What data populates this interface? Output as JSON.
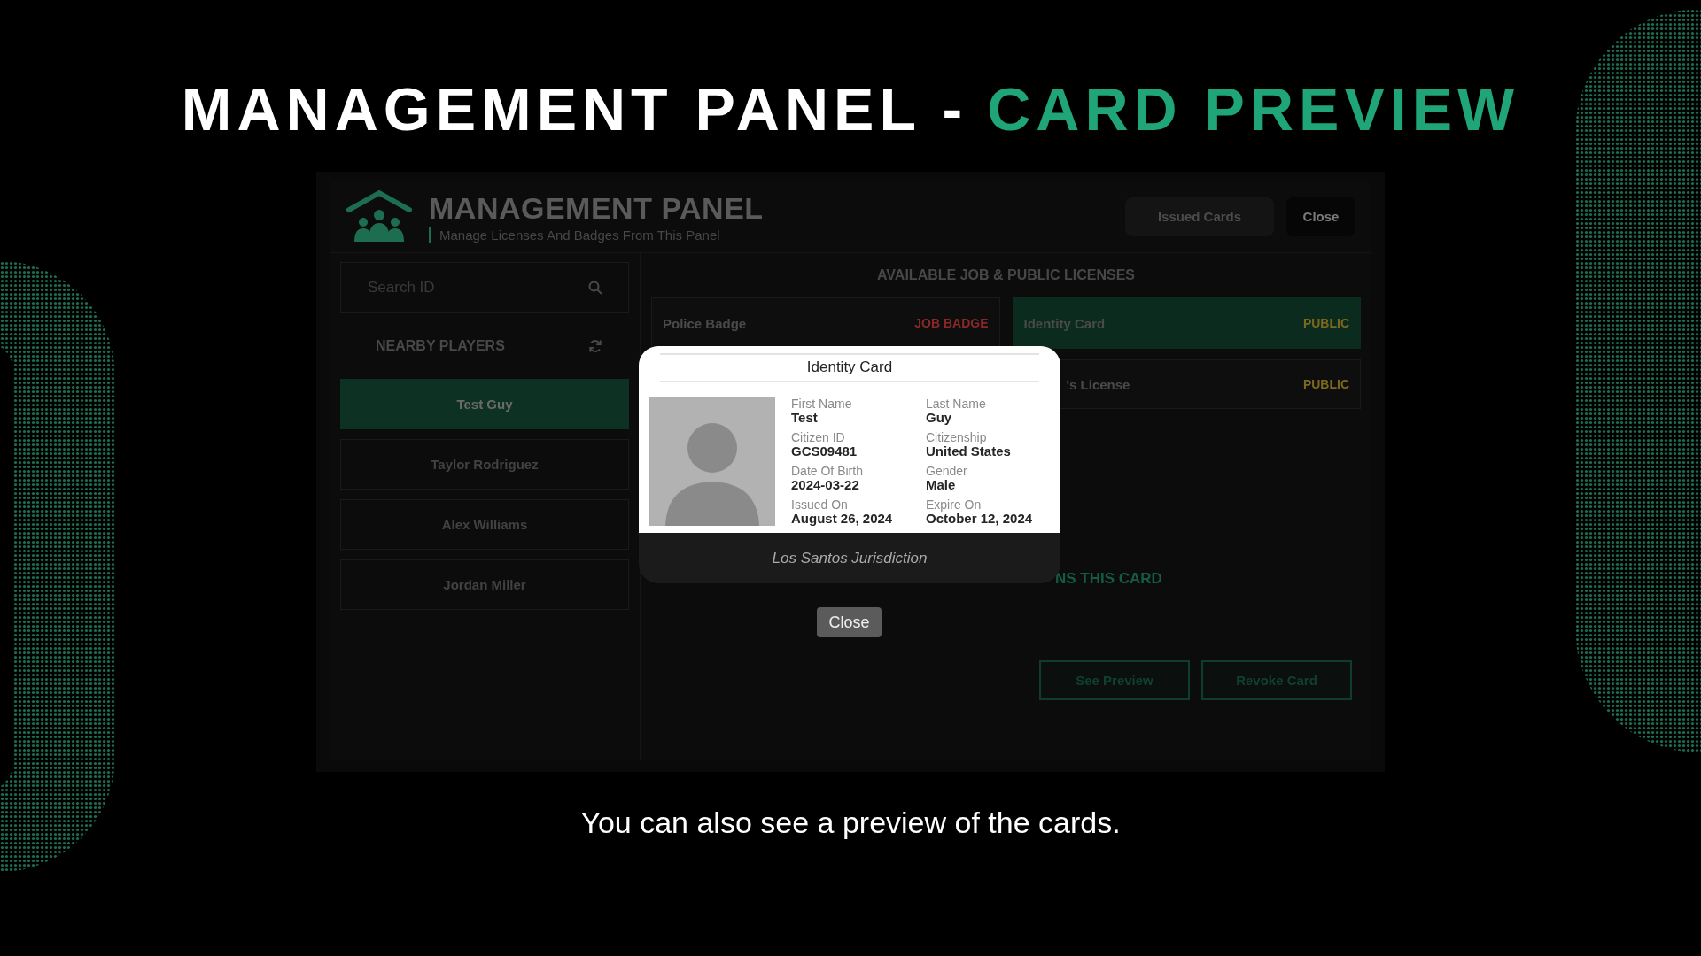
{
  "headline": {
    "text": "MANAGEMENT PANEL -",
    "highlight": "CARD PREVIEW"
  },
  "panel": {
    "title": "MANAGEMENT PANEL",
    "subtitle": "Manage Licenses And Badges From This Panel",
    "buttons": [
      {
        "label": "Issued Cards",
        "kind": "secondary"
      },
      {
        "label": "Close",
        "kind": "primary"
      }
    ],
    "search": {
      "placeholder": "Search ID"
    },
    "nearby_title": "NEARBY PLAYERS",
    "players": [
      {
        "name": "Test Guy",
        "selected": true
      },
      {
        "name": "Taylor Rodriguez",
        "selected": false
      },
      {
        "name": "Alex Williams",
        "selected": false
      },
      {
        "name": "Jordan Miller",
        "selected": false
      }
    ],
    "licenses_title": "AVAILABLE JOB & PUBLIC LICENSES",
    "licenses": [
      {
        "name": "Police Badge",
        "tag": "JOB BADGE",
        "kind": "job",
        "selected": false,
        "partial": false
      },
      {
        "name": "Identity Card",
        "tag": "PUBLIC",
        "kind": "public",
        "selected": true,
        "partial": false
      },
      {
        "name": "'s License",
        "tag": "PUBLIC",
        "kind": "public",
        "selected": false,
        "partial": true
      }
    ],
    "assign_note": "NS THIS CARD",
    "actions": [
      "See Preview",
      "Revoke Card"
    ]
  },
  "preview": {
    "title": "Identity Card",
    "fields": [
      {
        "label": "First Name",
        "value": "Test"
      },
      {
        "label": "Last Name",
        "value": "Guy"
      },
      {
        "label": "Citizen ID",
        "value": "GCS09481"
      },
      {
        "label": "Citizenship",
        "value": "United States"
      },
      {
        "label": "Date Of Birth",
        "value": "2024-03-22"
      },
      {
        "label": "Gender",
        "value": "Male"
      },
      {
        "label": "Issued On",
        "value": "August 26, 2024"
      },
      {
        "label": "Expire On",
        "value": "October 12, 2024"
      }
    ],
    "footer": "Los Santos Jurisdiction",
    "close": "Close"
  },
  "caption": "You can also see a preview of the cards."
}
